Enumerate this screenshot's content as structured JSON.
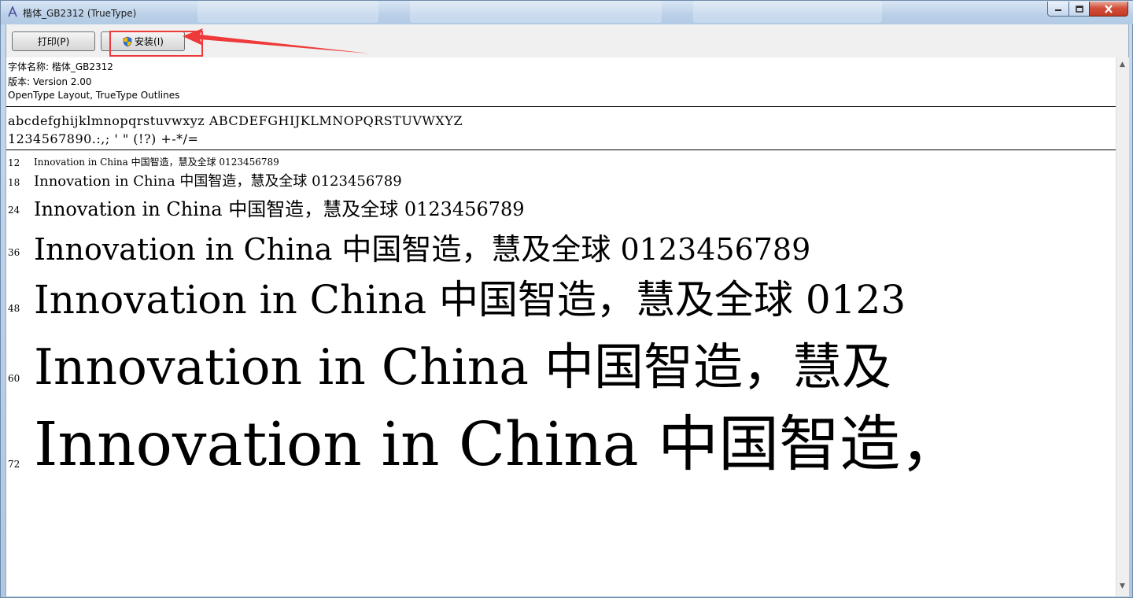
{
  "window": {
    "title": "楷体_GB2312 (TrueType)",
    "controls": {
      "minimize_icon": "minimize-icon",
      "maximize_icon": "maximize-icon",
      "close_icon": "close-icon"
    }
  },
  "toolbar": {
    "print_label": "打印(P)",
    "install_label": "安装(I)",
    "install_icon": "uac-shield-icon"
  },
  "annotation": {
    "highlight_color": "#ee3a3a",
    "arrow_color": "#ee3a3a"
  },
  "font_info": {
    "name_line": "字体名称: 楷体_GB2312",
    "version_line": "版本: Version 2.00",
    "outline_line": "OpenType Layout, TrueType Outlines"
  },
  "charset": {
    "letters": "abcdefghijklmnopqrstuvwxyz ABCDEFGHIJKLMNOPQRSTUVWXYZ",
    "digits_symbols": "1234567890.:,; ' \" (!?) +-*/="
  },
  "samples": [
    {
      "size": "12",
      "text": "Innovation in China 中国智造，慧及全球 0123456789"
    },
    {
      "size": "18",
      "text": "Innovation in China 中国智造，慧及全球 0123456789"
    },
    {
      "size": "24",
      "text": "Innovation in China 中国智造，慧及全球 0123456789"
    },
    {
      "size": "36",
      "text": "Innovation in China 中国智造，慧及全球 0123456789"
    },
    {
      "size": "48",
      "text": "Innovation in China 中国智造，慧及全球 0123"
    },
    {
      "size": "60",
      "text": "Innovation in China 中国智造，慧及"
    },
    {
      "size": "72",
      "text": "Innovation in China 中国智造，"
    }
  ]
}
